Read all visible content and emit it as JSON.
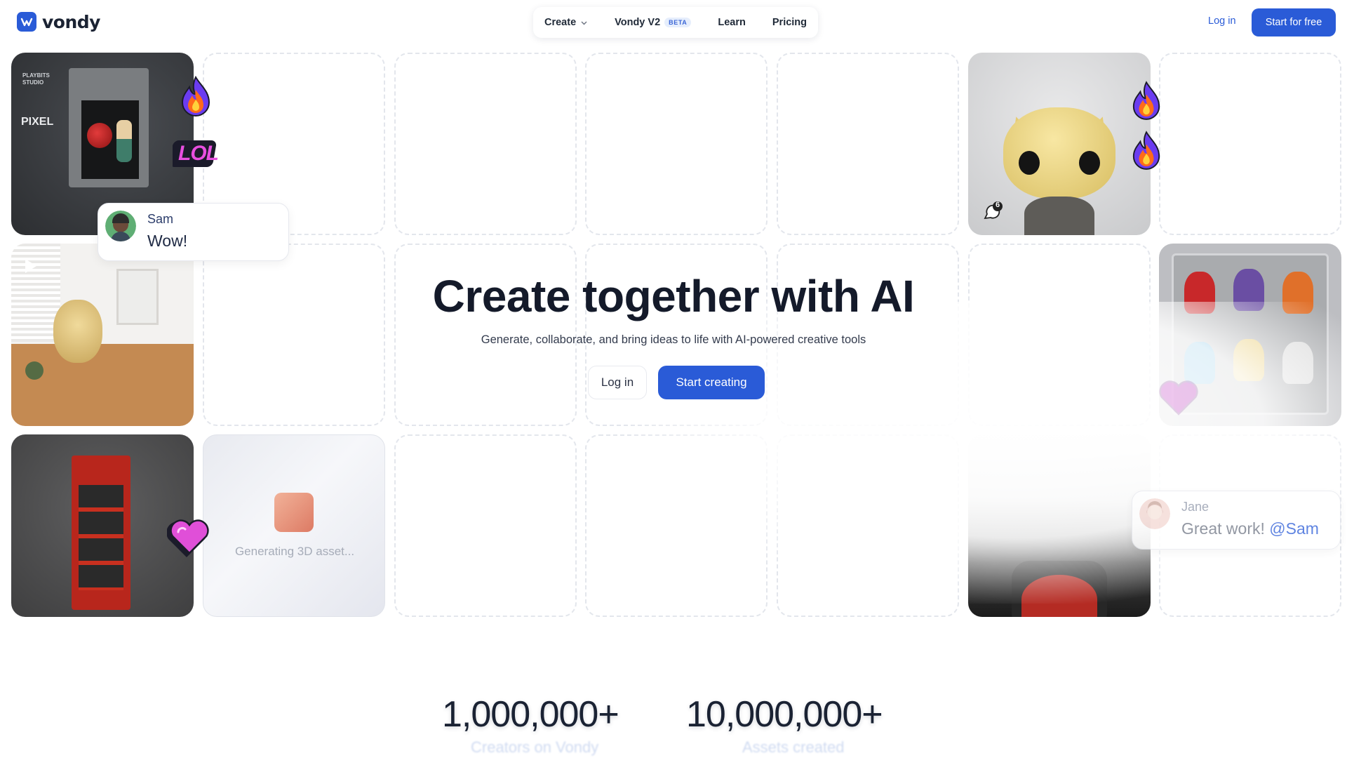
{
  "header": {
    "logo_text": "vondy",
    "nav": {
      "create": "Create",
      "vondy_v2": "Vondy V2",
      "beta_badge": "BETA",
      "learn": "Learn",
      "pricing": "Pricing"
    },
    "login": "Log in",
    "start_free": "Start for free"
  },
  "hero": {
    "title": "Create together with AI",
    "subtitle": "Generate, collaborate, and bring ideas to life with AI-powered creative tools",
    "login": "Log in",
    "start": "Start creating"
  },
  "tiles": {
    "playbits_brand_line1": "PLAYBITS",
    "playbits_brand_line2": "STUDIO",
    "playbits_pixel": "PIXEL",
    "generating_text": "Generating 3D asset...",
    "comment_count": "6",
    "lol_sticker": "LOL"
  },
  "chats": {
    "sam": {
      "name": "Sam",
      "message": "Wow!"
    },
    "jane": {
      "name": "Jane",
      "message": "Great work!",
      "mention": "@Sam"
    }
  },
  "stats": [
    {
      "value": "1,000,000+",
      "label": "Creators on Vondy"
    },
    {
      "value": "10,000,000+",
      "label": "Assets created"
    }
  ],
  "colors": {
    "brand": "#2a5bd7",
    "heading": "#141a2a"
  }
}
